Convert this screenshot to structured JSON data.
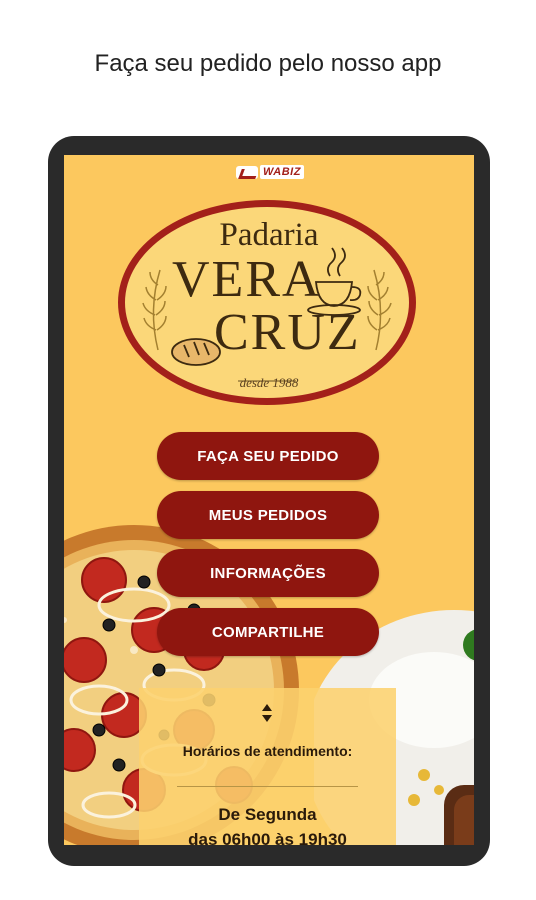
{
  "headline": "Faça seu pedido pelo nosso app",
  "brand": {
    "name": "WABIZ",
    "icon": "wabiz-logo-icon"
  },
  "logo": {
    "line1": "Padaria",
    "line2": "VERA",
    "line3": "CRUZ",
    "since": "desde 1988",
    "colors": {
      "ring": "#a3201a",
      "text": "#3d2a10"
    }
  },
  "buttons": [
    {
      "label": "FAÇA SEU PEDIDO"
    },
    {
      "label": "MEUS PEDIDOS"
    },
    {
      "label": "INFORMAÇÕES"
    },
    {
      "label": "COMPARTILHE"
    }
  ],
  "hours": {
    "title": "Horários de atendimento:",
    "day": "De Segunda",
    "time": "das 06h00 às 19h30",
    "icon": "sort-arrows-icon"
  },
  "colors": {
    "background": "#fcc85e",
    "button": "#8f160f"
  }
}
